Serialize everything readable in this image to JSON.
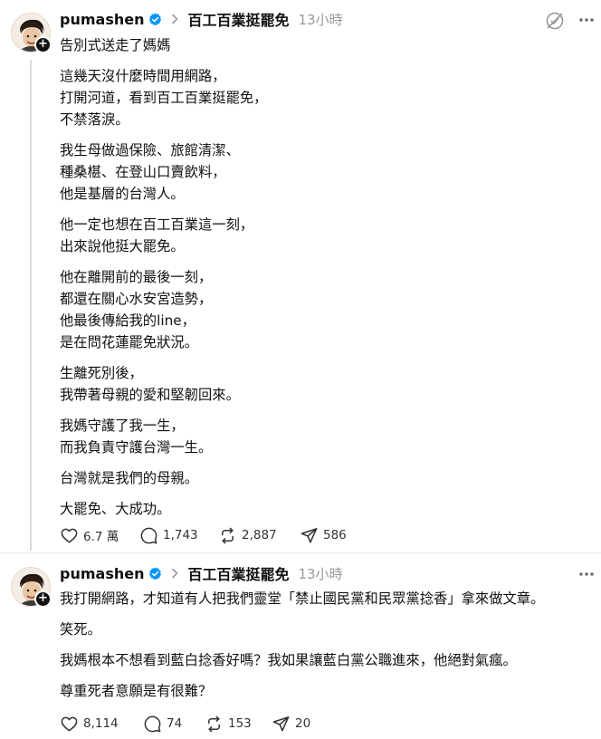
{
  "posts": [
    {
      "username": "pumashen",
      "community": "百工百業挺罷免",
      "time": "13小時",
      "paragraphs": [
        [
          "告別式送走了媽媽"
        ],
        [
          "這幾天沒什麼時間用網路，",
          "打開河道，看到百工百業挺罷免，",
          "不禁落淚。"
        ],
        [
          "我生母做過保險、旅館清潔、",
          "種桑椹、在登山口賣飲料，",
          "他是基層的台灣人。"
        ],
        [
          "他一定也想在百工百業這一刻，",
          "出來說他挺大罷免。"
        ],
        [
          "他在離開前的最後一刻，",
          "都還在關心水安宮造勢，",
          "他最後傳給我的line，",
          "是在問花蓮罷免狀況。"
        ],
        [
          "生離死別後，",
          "我帶著母親的愛和堅韌回來。"
        ],
        [
          "我媽守護了我一生，",
          "而我負責守護台灣一生。"
        ],
        [
          "台灣就是我們的母親。"
        ],
        [
          "大罷免、大成功。"
        ]
      ],
      "stats": {
        "likes": "6.7 萬",
        "replies": "1,743",
        "reposts": "2,887",
        "shares": "586"
      }
    },
    {
      "username": "pumashen",
      "community": "百工百業挺罷免",
      "time": "13小時",
      "paragraphs": [
        [
          "我打開網路，才知道有人把我們靈堂「禁止國民黨和民眾黨捻香」拿來做文章。"
        ],
        [
          "笑死。"
        ],
        [
          "我媽根本不想看到藍白捻香好嗎？我如果讓藍白黨公職進來，他絕對氣瘋。"
        ],
        [
          "尊重死者意願是有很難？"
        ]
      ],
      "stats": {
        "likes": "8,114",
        "replies": "74",
        "reposts": "153",
        "shares": "20"
      }
    }
  ],
  "icons": {
    "verified": "verified-badge-icon",
    "chevron": "chevron-right-icon",
    "like": "heart-icon",
    "reply": "comment-icon",
    "repost": "repost-icon",
    "share": "send-icon",
    "more": "more-icon",
    "repost_off": "repost-off-icon"
  },
  "colors": {
    "text": "#101010",
    "muted": "#999999",
    "verified": "#0095f6",
    "divider": "#e8e8e8"
  }
}
